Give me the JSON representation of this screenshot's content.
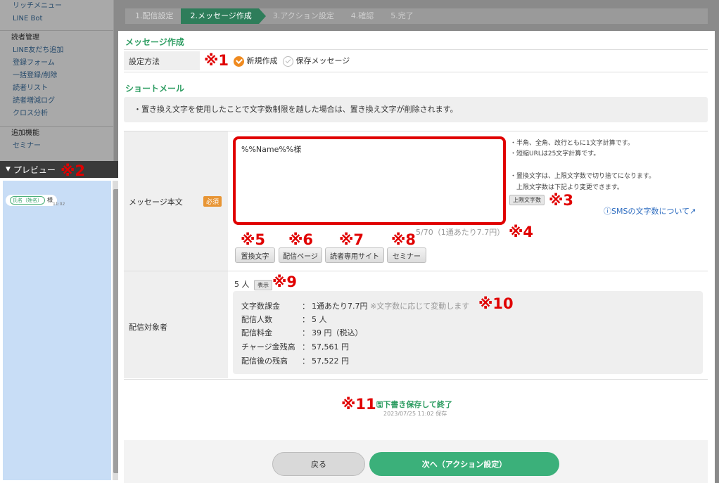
{
  "sidebar": {
    "items_top": [
      "リッチメニュー",
      "LINE Bot"
    ],
    "group1_title": "読者管理",
    "group1": [
      "LINE友だち追加",
      "登録フォーム",
      "一括登録/削除",
      "読者リスト",
      "読者増減ログ",
      "クロス分析"
    ],
    "group2_title": "追加機能",
    "group2": [
      "セミナー"
    ]
  },
  "steps": [
    "1.配信設定",
    "2.メッセージ作成",
    "3.アクション設定",
    "4.確認",
    "5.完了"
  ],
  "preview": {
    "title": "プレビュー",
    "bubble_tag": "氏名（姓名）",
    "bubble_text": "様",
    "bubble_time": "11:02"
  },
  "section_message": {
    "title": "メッセージ作成",
    "method_label": "設定方法",
    "option_new": "新規作成",
    "option_saved": "保存メッセージ"
  },
  "section_sms": {
    "title": "ショートメール",
    "notice": "・置き換え文字を使用したことで文字数制限を越した場合は、置き換え文字が削除されます。"
  },
  "body_field": {
    "label": "メッセージ本文",
    "required": "必須",
    "value": "%%Name%%様",
    "hints": [
      "・半角、全角、改行ともに1文字計算です。",
      "・短縮URLは25文字計算です。",
      "・置換文字は、上限文字数で切り捨てになります。",
      "上限文字数は下記より変更できます。"
    ],
    "limit_button": "上限文字数",
    "sms_link": "SMSの文字数について",
    "counter": "5/70（1通あたり7.7円）",
    "insert_buttons": [
      "置換文字",
      "配信ページ",
      "読者専用サイト",
      "セミナー"
    ]
  },
  "recipients": {
    "label": "配信対象者",
    "count": "5 人",
    "show_button": "表示",
    "rows": [
      {
        "key": "文字数課金",
        "value": "1通あたり7.7円",
        "note": "※文字数に応じて変動します"
      },
      {
        "key": "配信人数",
        "value": "5 人",
        "note": ""
      },
      {
        "key": "配信料金",
        "value": "39 円（税込）",
        "note": ""
      },
      {
        "key": "チャージ金残高",
        "value": "57,561 円",
        "note": ""
      },
      {
        "key": "配信後の残高",
        "value": "57,522 円",
        "note": ""
      }
    ],
    "colon": "："
  },
  "draft": {
    "label": "下書き保存して終了",
    "saved_at": "2023/07/25 11:02 保存"
  },
  "footer": {
    "back": "戻る",
    "next": "次へ（アクション設定）"
  },
  "annotations": [
    "※1",
    "※2",
    "※3",
    "※4",
    "※5",
    "※6",
    "※7",
    "※8",
    "※9",
    "※10",
    "※11"
  ],
  "colors": {
    "accent_green": "#2e9d62",
    "annotation_red": "#e00000",
    "radio_orange": "#ef8a1f",
    "next_button": "#3bb07a"
  }
}
